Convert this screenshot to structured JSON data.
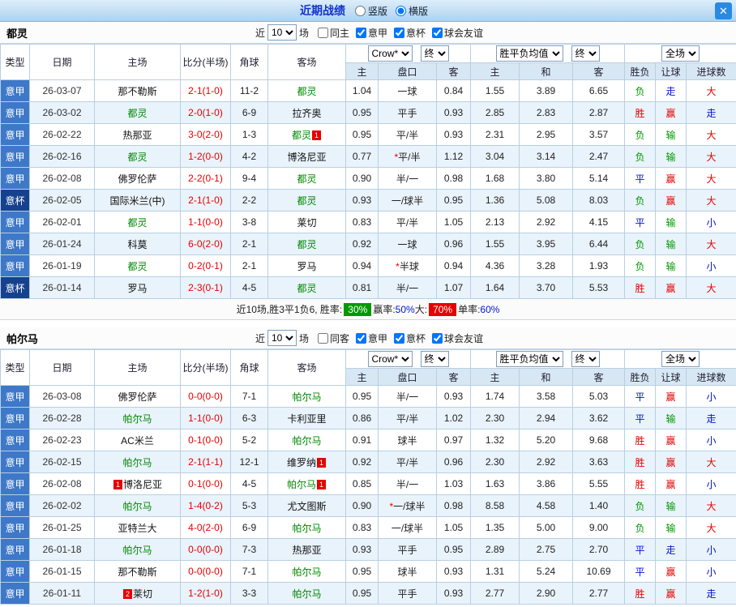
{
  "topbar": {
    "title": "近期战绩",
    "layout_options": [
      {
        "label": "竖版",
        "selected": false
      },
      {
        "label": "横版",
        "selected": true
      }
    ],
    "close": "✕"
  },
  "colors": {
    "serie_a_badge": "#3e78c8",
    "coppa_badge": "#16418f",
    "win_red": "#e60000",
    "lose_green": "#009900",
    "push_blue": "#0014cc",
    "subject_team_green": "#008800",
    "score_red": "#e60000"
  },
  "table_columns": {
    "left": [
      "类型",
      "日期",
      "主场",
      "比分(半场)",
      "角球",
      "客场"
    ],
    "sub": [
      "主",
      "盘口",
      "客",
      "主",
      "和",
      "客",
      "胜负",
      "让球",
      "进球数"
    ]
  },
  "sections": [
    {
      "team": "都灵",
      "filter": {
        "near": "近",
        "count": "10",
        "games": "场",
        "checkboxes": [
          {
            "label": "同主",
            "checked": false
          },
          {
            "label": "意甲",
            "checked": true
          },
          {
            "label": "意杯",
            "checked": true
          },
          {
            "label": "球会友谊",
            "checked": true
          }
        ]
      },
      "dropdowns": {
        "company": "Crow*",
        "final1": "终",
        "avg": "胜平负均值",
        "final2": "终",
        "scope": "全场"
      },
      "rows": [
        {
          "type": "意甲",
          "date": "26-03-07",
          "home": {
            "name": "那不勒斯",
            "subject": false,
            "card": null
          },
          "score": "2-1(1-0)",
          "corner": "11-2",
          "away": {
            "name": "都灵",
            "subject": true,
            "card": null
          },
          "odds": [
            "1.04",
            "一球",
            "0.84"
          ],
          "avg": [
            "1.55",
            "3.89",
            "6.65"
          ],
          "verdicts": [
            {
              "t": "负",
              "c": "green"
            },
            {
              "t": "走",
              "c": "blue"
            },
            {
              "t": "大",
              "c": "red"
            }
          ]
        },
        {
          "type": "意甲",
          "date": "26-03-02",
          "home": {
            "name": "都灵",
            "subject": true,
            "card": null
          },
          "score": "2-0(1-0)",
          "corner": "6-9",
          "away": {
            "name": "拉齐奥",
            "subject": false,
            "card": null
          },
          "odds": [
            "0.95",
            "平手",
            "0.93"
          ],
          "avg": [
            "2.85",
            "2.83",
            "2.87"
          ],
          "verdicts": [
            {
              "t": "胜",
              "c": "red"
            },
            {
              "t": "赢",
              "c": "red"
            },
            {
              "t": "走",
              "c": "blue"
            }
          ]
        },
        {
          "type": "意甲",
          "date": "26-02-22",
          "home": {
            "name": "热那亚",
            "subject": false,
            "card": null
          },
          "score": "3-0(2-0)",
          "corner": "1-3",
          "away": {
            "name": "都灵",
            "subject": true,
            "card": "1"
          },
          "odds": [
            "0.95",
            "平/半",
            "0.93"
          ],
          "avg": [
            "2.31",
            "2.95",
            "3.57"
          ],
          "verdicts": [
            {
              "t": "负",
              "c": "green"
            },
            {
              "t": "输",
              "c": "green"
            },
            {
              "t": "大",
              "c": "red"
            }
          ]
        },
        {
          "type": "意甲",
          "date": "26-02-16",
          "home": {
            "name": "都灵",
            "subject": true,
            "card": null
          },
          "score": "1-2(0-0)",
          "corner": "4-2",
          "away": {
            "name": "博洛尼亚",
            "subject": false,
            "card": null
          },
          "odds": [
            "0.77",
            "*平/半",
            "1.12"
          ],
          "avg": [
            "3.04",
            "3.14",
            "2.47"
          ],
          "verdicts": [
            {
              "t": "负",
              "c": "green"
            },
            {
              "t": "输",
              "c": "green"
            },
            {
              "t": "大",
              "c": "red"
            }
          ]
        },
        {
          "type": "意甲",
          "date": "26-02-08",
          "home": {
            "name": "佛罗伦萨",
            "subject": false,
            "card": null
          },
          "score": "2-2(0-1)",
          "corner": "9-4",
          "away": {
            "name": "都灵",
            "subject": true,
            "card": null
          },
          "odds": [
            "0.90",
            "半/一",
            "0.98"
          ],
          "avg": [
            "1.68",
            "3.80",
            "5.14"
          ],
          "verdicts": [
            {
              "t": "平",
              "c": "blue"
            },
            {
              "t": "赢",
              "c": "red"
            },
            {
              "t": "大",
              "c": "red"
            }
          ]
        },
        {
          "type": "意杯",
          "date": "26-02-05",
          "home": {
            "name": "国际米兰(中)",
            "subject": false,
            "card": null
          },
          "score": "2-1(1-0)",
          "corner": "2-2",
          "away": {
            "name": "都灵",
            "subject": true,
            "card": null
          },
          "odds": [
            "0.93",
            "一/球半",
            "0.95"
          ],
          "avg": [
            "1.36",
            "5.08",
            "8.03"
          ],
          "verdicts": [
            {
              "t": "负",
              "c": "green"
            },
            {
              "t": "赢",
              "c": "red"
            },
            {
              "t": "大",
              "c": "red"
            }
          ]
        },
        {
          "type": "意甲",
          "date": "26-02-01",
          "home": {
            "name": "都灵",
            "subject": true,
            "card": null
          },
          "score": "1-1(0-0)",
          "corner": "3-8",
          "away": {
            "name": "莱切",
            "subject": false,
            "card": null
          },
          "odds": [
            "0.83",
            "平/半",
            "1.05"
          ],
          "avg": [
            "2.13",
            "2.92",
            "4.15"
          ],
          "verdicts": [
            {
              "t": "平",
              "c": "blue"
            },
            {
              "t": "输",
              "c": "green"
            },
            {
              "t": "小",
              "c": "blue"
            }
          ]
        },
        {
          "type": "意甲",
          "date": "26-01-24",
          "home": {
            "name": "科莫",
            "subject": false,
            "card": null
          },
          "score": "6-0(2-0)",
          "corner": "2-1",
          "away": {
            "name": "都灵",
            "subject": true,
            "card": null
          },
          "odds": [
            "0.92",
            "一球",
            "0.96"
          ],
          "avg": [
            "1.55",
            "3.95",
            "6.44"
          ],
          "verdicts": [
            {
              "t": "负",
              "c": "green"
            },
            {
              "t": "输",
              "c": "green"
            },
            {
              "t": "大",
              "c": "red"
            }
          ]
        },
        {
          "type": "意甲",
          "date": "26-01-19",
          "home": {
            "name": "都灵",
            "subject": true,
            "card": null
          },
          "score": "0-2(0-1)",
          "corner": "2-1",
          "away": {
            "name": "罗马",
            "subject": false,
            "card": null
          },
          "odds": [
            "0.94",
            "*半球",
            "0.94"
          ],
          "avg": [
            "4.36",
            "3.28",
            "1.93"
          ],
          "verdicts": [
            {
              "t": "负",
              "c": "green"
            },
            {
              "t": "输",
              "c": "green"
            },
            {
              "t": "小",
              "c": "blue"
            }
          ]
        },
        {
          "type": "意杯",
          "date": "26-01-14",
          "home": {
            "name": "罗马",
            "subject": false,
            "card": null
          },
          "score": "2-3(0-1)",
          "corner": "4-5",
          "away": {
            "name": "都灵",
            "subject": true,
            "card": null
          },
          "odds": [
            "0.81",
            "半/一",
            "1.07"
          ],
          "avg": [
            "1.64",
            "3.70",
            "5.53"
          ],
          "verdicts": [
            {
              "t": "胜",
              "c": "red"
            },
            {
              "t": "赢",
              "c": "red"
            },
            {
              "t": "大",
              "c": "red"
            }
          ]
        }
      ],
      "summary": [
        {
          "text": "近10场,胜3平1负6, 胜率: ",
          "style": "plain"
        },
        {
          "text": "30%",
          "style": "badge-green"
        },
        {
          "text": " 赢率:",
          "style": "plain"
        },
        {
          "text": "50%",
          "style": "blue"
        },
        {
          "text": " 大: ",
          "style": "plain"
        },
        {
          "text": "70%",
          "style": "badge-red"
        },
        {
          "text": " 单率:",
          "style": "plain"
        },
        {
          "text": "60%",
          "style": "blue"
        }
      ]
    },
    {
      "team": "帕尔马",
      "filter": {
        "near": "近",
        "count": "10",
        "games": "场",
        "checkboxes": [
          {
            "label": "同客",
            "checked": false
          },
          {
            "label": "意甲",
            "checked": true
          },
          {
            "label": "意杯",
            "checked": true
          },
          {
            "label": "球会友谊",
            "checked": true
          }
        ]
      },
      "dropdowns": {
        "company": "Crow*",
        "final1": "终",
        "avg": "胜平负均值",
        "final2": "终",
        "scope": "全场"
      },
      "rows": [
        {
          "type": "意甲",
          "date": "26-03-08",
          "home": {
            "name": "佛罗伦萨",
            "subject": false,
            "card": null
          },
          "score": "0-0(0-0)",
          "corner": "7-1",
          "away": {
            "name": "帕尔马",
            "subject": true,
            "card": null
          },
          "odds": [
            "0.95",
            "半/一",
            "0.93"
          ],
          "avg": [
            "1.74",
            "3.58",
            "5.03"
          ],
          "verdicts": [
            {
              "t": "平",
              "c": "blue"
            },
            {
              "t": "赢",
              "c": "red"
            },
            {
              "t": "小",
              "c": "blue"
            }
          ]
        },
        {
          "type": "意甲",
          "date": "26-02-28",
          "home": {
            "name": "帕尔马",
            "subject": true,
            "card": null
          },
          "score": "1-1(0-0)",
          "corner": "6-3",
          "away": {
            "name": "卡利亚里",
            "subject": false,
            "card": null
          },
          "odds": [
            "0.86",
            "平/半",
            "1.02"
          ],
          "avg": [
            "2.30",
            "2.94",
            "3.62"
          ],
          "verdicts": [
            {
              "t": "平",
              "c": "blue"
            },
            {
              "t": "输",
              "c": "green"
            },
            {
              "t": "走",
              "c": "blue"
            }
          ]
        },
        {
          "type": "意甲",
          "date": "26-02-23",
          "home": {
            "name": "AC米兰",
            "subject": false,
            "card": null
          },
          "score": "0-1(0-0)",
          "corner": "5-2",
          "away": {
            "name": "帕尔马",
            "subject": true,
            "card": null
          },
          "odds": [
            "0.91",
            "球半",
            "0.97"
          ],
          "avg": [
            "1.32",
            "5.20",
            "9.68"
          ],
          "verdicts": [
            {
              "t": "胜",
              "c": "red"
            },
            {
              "t": "赢",
              "c": "red"
            },
            {
              "t": "小",
              "c": "blue"
            }
          ]
        },
        {
          "type": "意甲",
          "date": "26-02-15",
          "home": {
            "name": "帕尔马",
            "subject": true,
            "card": null
          },
          "score": "2-1(1-1)",
          "corner": "12-1",
          "away": {
            "name": "维罗纳",
            "subject": false,
            "card": "1"
          },
          "odds": [
            "0.92",
            "平/半",
            "0.96"
          ],
          "avg": [
            "2.30",
            "2.92",
            "3.63"
          ],
          "verdicts": [
            {
              "t": "胜",
              "c": "red"
            },
            {
              "t": "赢",
              "c": "red"
            },
            {
              "t": "大",
              "c": "red"
            }
          ]
        },
        {
          "type": "意甲",
          "date": "26-02-08",
          "home": {
            "name": "博洛尼亚",
            "subject": false,
            "card": "1"
          },
          "score": "0-1(0-0)",
          "corner": "4-5",
          "away": {
            "name": "帕尔马",
            "subject": true,
            "card": "1"
          },
          "odds": [
            "0.85",
            "半/一",
            "1.03"
          ],
          "avg": [
            "1.63",
            "3.86",
            "5.55"
          ],
          "verdicts": [
            {
              "t": "胜",
              "c": "red"
            },
            {
              "t": "赢",
              "c": "red"
            },
            {
              "t": "小",
              "c": "blue"
            }
          ]
        },
        {
          "type": "意甲",
          "date": "26-02-02",
          "home": {
            "name": "帕尔马",
            "subject": true,
            "card": null
          },
          "score": "1-4(0-2)",
          "corner": "5-3",
          "away": {
            "name": "尤文图斯",
            "subject": false,
            "card": null
          },
          "odds": [
            "0.90",
            "*一/球半",
            "0.98"
          ],
          "avg": [
            "8.58",
            "4.58",
            "1.40"
          ],
          "verdicts": [
            {
              "t": "负",
              "c": "green"
            },
            {
              "t": "输",
              "c": "green"
            },
            {
              "t": "大",
              "c": "red"
            }
          ]
        },
        {
          "type": "意甲",
          "date": "26-01-25",
          "home": {
            "name": "亚特兰大",
            "subject": false,
            "card": null
          },
          "score": "4-0(2-0)",
          "corner": "6-9",
          "away": {
            "name": "帕尔马",
            "subject": true,
            "card": null
          },
          "odds": [
            "0.83",
            "一/球半",
            "1.05"
          ],
          "avg": [
            "1.35",
            "5.00",
            "9.00"
          ],
          "verdicts": [
            {
              "t": "负",
              "c": "green"
            },
            {
              "t": "输",
              "c": "green"
            },
            {
              "t": "大",
              "c": "red"
            }
          ]
        },
        {
          "type": "意甲",
          "date": "26-01-18",
          "home": {
            "name": "帕尔马",
            "subject": true,
            "card": null
          },
          "score": "0-0(0-0)",
          "corner": "7-3",
          "away": {
            "name": "热那亚",
            "subject": false,
            "card": null
          },
          "odds": [
            "0.93",
            "平手",
            "0.95"
          ],
          "avg": [
            "2.89",
            "2.75",
            "2.70"
          ],
          "verdicts": [
            {
              "t": "平",
              "c": "blue"
            },
            {
              "t": "走",
              "c": "blue"
            },
            {
              "t": "小",
              "c": "blue"
            }
          ]
        },
        {
          "type": "意甲",
          "date": "26-01-15",
          "home": {
            "name": "那不勒斯",
            "subject": false,
            "card": null
          },
          "score": "0-0(0-0)",
          "corner": "7-1",
          "away": {
            "name": "帕尔马",
            "subject": true,
            "card": null
          },
          "odds": [
            "0.95",
            "球半",
            "0.93"
          ],
          "avg": [
            "1.31",
            "5.24",
            "10.69"
          ],
          "verdicts": [
            {
              "t": "平",
              "c": "blue"
            },
            {
              "t": "赢",
              "c": "red"
            },
            {
              "t": "小",
              "c": "blue"
            }
          ]
        },
        {
          "type": "意甲",
          "date": "26-01-11",
          "home": {
            "name": "莱切",
            "subject": false,
            "card": "2"
          },
          "score": "1-2(1-0)",
          "corner": "3-3",
          "away": {
            "name": "帕尔马",
            "subject": true,
            "card": null
          },
          "odds": [
            "0.95",
            "平手",
            "0.93"
          ],
          "avg": [
            "2.77",
            "2.90",
            "2.77"
          ],
          "verdicts": [
            {
              "t": "胜",
              "c": "red"
            },
            {
              "t": "赢",
              "c": "red"
            },
            {
              "t": "走",
              "c": "blue"
            }
          ]
        }
      ],
      "summary": null
    }
  ]
}
